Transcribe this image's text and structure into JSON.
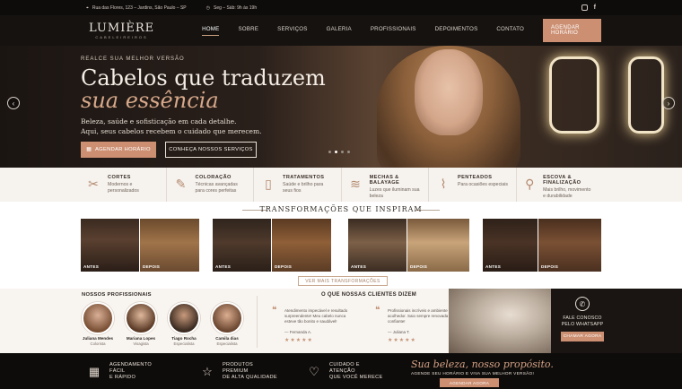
{
  "topbar": {
    "address": "Rua das Flores, 123 – Jardins, São Paulo – SP",
    "hours": "Seg – Sáb: 9h às 19h",
    "social": [
      "instagram-icon",
      "facebook-icon"
    ]
  },
  "brand": {
    "name": "LUMIÈRE",
    "tagline": "CABELEIREIROS"
  },
  "nav": {
    "items": [
      "HOME",
      "SOBRE",
      "SERVIÇOS",
      "GALERIA",
      "PROFISSIONAIS",
      "DEPOIMENTOS",
      "CONTATO"
    ],
    "active": "HOME",
    "cta": "AGENDAR HORÁRIO"
  },
  "hero": {
    "eyebrow": "REALCE SUA MELHOR VERSÃO",
    "title_line1": "Cabelos que traduzem",
    "title_line2": "sua essência",
    "subtitle_line1": "Beleza, saúde e sofisticação em cada detalhe.",
    "subtitle_line2": "Aqui, seus cabelos recebem o cuidado que merecem.",
    "btn_primary": "AGENDAR HORÁRIO",
    "btn_secondary": "CONHEÇA NOSSOS SERVIÇOS",
    "slides": 4,
    "active_slide": 1
  },
  "services": [
    {
      "icon": "scissors-icon",
      "title": "CORTES",
      "desc": "Modernos e personalizados"
    },
    {
      "icon": "brush-icon",
      "title": "COLORAÇÃO",
      "desc": "Técnicas avançadas para cores perfeitas"
    },
    {
      "icon": "bottle-icon",
      "title": "TRATAMENTOS",
      "desc": "Saúde e brilho para seus fios"
    },
    {
      "icon": "hair-icon",
      "title": "MECHAS & BALAYAGE",
      "desc": "Luzes que iluminam sua beleza"
    },
    {
      "icon": "comb-icon",
      "title": "PENTEADOS",
      "desc": "Para ocasiões especiais"
    },
    {
      "icon": "dryer-icon",
      "title": "ESCOVA & FINALIZAÇÃO",
      "desc": "Mais brilho, movimento e durabilidade"
    }
  ],
  "transformations": {
    "title": "TRANSFORMAÇÕES QUE INSPIRAM",
    "before_label": "ANTES",
    "after_label": "DEPOIS",
    "cta": "VER MAIS TRANSFORMAÇÕES"
  },
  "professionals": {
    "title": "NOSSOS PROFISSIONAIS",
    "people": [
      {
        "name": "Juliana Mendes",
        "role": "Colorista"
      },
      {
        "name": "Mariana Lopes",
        "role": "Visagista"
      },
      {
        "name": "Tiago Rocha",
        "role": "Especialista"
      },
      {
        "name": "Camila dias",
        "role": "Especialista"
      }
    ]
  },
  "testimonials": {
    "title": "O QUE NOSSAS CLIENTES DIZEM",
    "items": [
      {
        "text": "Atendimento impecável e resultado surpreendente! Meu cabelo nunca esteve tão bonito e saudável!",
        "name": "— Fernanda A.",
        "stars": "★★★★★"
      },
      {
        "text": "Profissionais incríveis e ambiente acolhedor. Saio sempre renovada e confiante!",
        "name": "— Juliana T.",
        "stars": "★★★★★"
      }
    ]
  },
  "whatsapp": {
    "line1": "FALE CONOSCO",
    "line2": "PELO WHATSAPP",
    "cta": "CHAMAR AGORA"
  },
  "footer": {
    "features": [
      {
        "icon": "calendar-icon",
        "line1": "AGENDAMENTO FÁCIL",
        "line2": "E RÁPIDO"
      },
      {
        "icon": "star-icon",
        "line1": "PRODUTOS PREMIUM",
        "line2": "DE ALTA QUALIDADE"
      },
      {
        "icon": "heart-icon",
        "line1": "CUIDADO E ATENÇÃO",
        "line2": "QUE VOCÊ MERECE"
      }
    ],
    "slogan": "Sua beleza, nosso propósito.",
    "slogan_sub": "AGENDE SEU HORÁRIO E VIVA SUA MELHOR VERSÃO!",
    "cta": "AGENDAR AGORA"
  },
  "colors": {
    "accent": "#cc8f72",
    "dark": "#0e0c0b",
    "cream": "#f6f2ee"
  }
}
